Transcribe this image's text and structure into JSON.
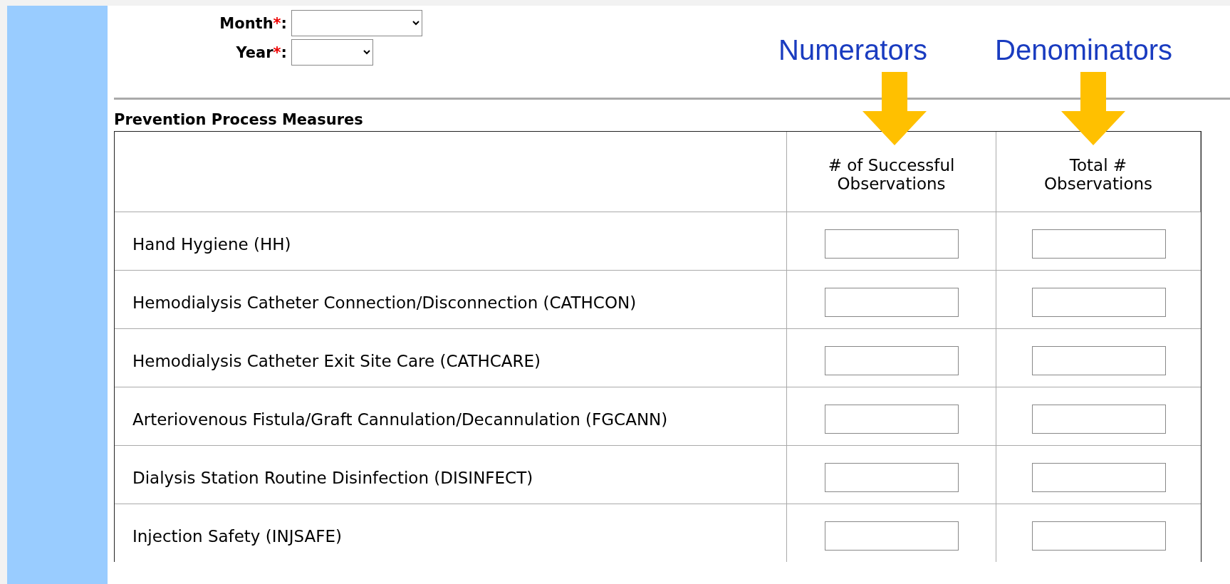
{
  "date_fields": [
    {
      "label": "Month",
      "required_mark": "*",
      "suffix": ":",
      "kind": "month"
    },
    {
      "label": "Year",
      "required_mark": "*",
      "suffix": ":",
      "kind": "year"
    }
  ],
  "annotations": [
    {
      "label": "Numerators"
    },
    {
      "label": "Denominators"
    }
  ],
  "table": {
    "title": "Prevention Process Measures",
    "columns": [
      {
        "label": "# of Successful Observations"
      },
      {
        "label": "Total # Observations"
      }
    ],
    "rows": [
      {
        "measure": "Hand Hygiene (HH)"
      },
      {
        "measure": "Hemodialysis Catheter Connection/Disconnection (CATHCON)"
      },
      {
        "measure": "Hemodialysis Catheter Exit Site Care (CATHCARE)"
      },
      {
        "measure": "Arteriovenous Fistula/Graft Cannulation/Decannulation (FGCANN)"
      },
      {
        "measure": "Dialysis Station Routine Disinfection (DISINFECT)"
      },
      {
        "measure": "Injection Safety (INJSAFE)"
      }
    ]
  }
}
